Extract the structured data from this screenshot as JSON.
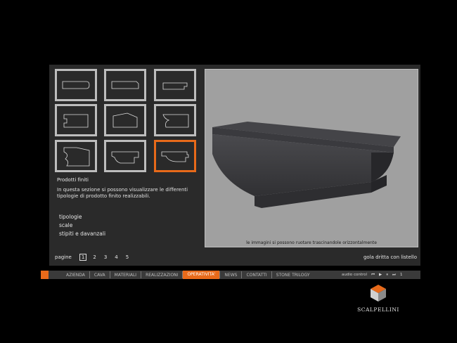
{
  "section": {
    "title": "Prodotti finiti",
    "description": "In questa sezione si possono visualizzare le differenti tipologie di prodotto finito realizzabili."
  },
  "links": [
    "tipologie",
    "scale",
    "stipiti e davanzali"
  ],
  "pager": {
    "label": "pagine",
    "pages": [
      "1",
      "2",
      "3",
      "4",
      "5"
    ],
    "current": "1"
  },
  "viewer": {
    "caption": "le immagini si possono ruotare trascinandole orizzontalmente"
  },
  "product": {
    "name": "gola dritta con listello"
  },
  "nav": {
    "items": [
      "AZIENDA",
      "CAVA",
      "MATERIALI",
      "REALIZZAZIONI",
      "OPERATIVITA'",
      "NEWS",
      "CONTATTI",
      "STONE TRILOGY"
    ],
    "active": "OPERATIVITA'"
  },
  "audio": {
    "label": "audio control",
    "track": "1"
  },
  "brand": {
    "name": "SCALPELLINI"
  },
  "colors": {
    "accent": "#e86a1a",
    "panel": "#2a2a2a",
    "background": "#000000",
    "viewer": "#a0a0a0"
  },
  "thumbnails": [
    {
      "icon": "profile-rounded-edge-icon"
    },
    {
      "icon": "profile-bevel-edge-icon"
    },
    {
      "icon": "profile-step-edge-icon"
    },
    {
      "icon": "profile-notched-block-icon"
    },
    {
      "icon": "profile-sloped-block-icon"
    },
    {
      "icon": "profile-cove-block-icon"
    },
    {
      "icon": "profile-ogee-block-icon"
    },
    {
      "icon": "profile-curved-step-icon"
    },
    {
      "icon": "profile-gola-listello-icon",
      "selected": true
    }
  ]
}
